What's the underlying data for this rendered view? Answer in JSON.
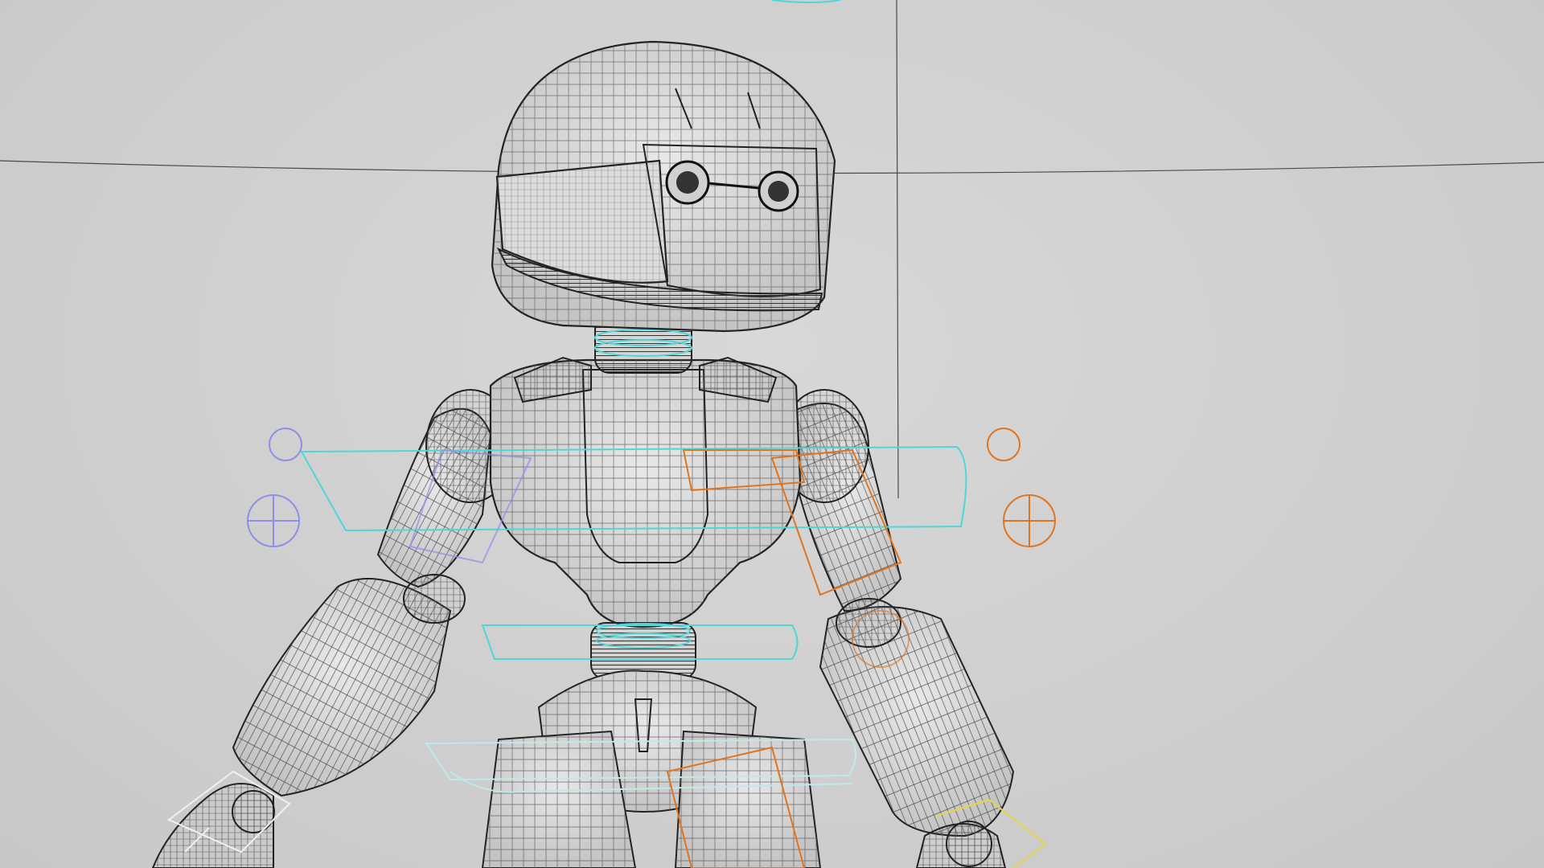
{
  "viewport": {
    "background_color": "#cfcfcf",
    "wire_color": "#2a2a2a",
    "grid_line_color": "#4a4a4a"
  },
  "rig": {
    "spine_control_color": "#4fd6d6",
    "right_side_control_color": "#e0741f",
    "left_side_control_color": "#8e8ee8",
    "hand_ik_color": "#f0f0f0",
    "right_hand_ik_color": "#e6d34a"
  },
  "icons": {
    "left_pole_vector": "crosshair-circle-icon",
    "right_pole_vector": "crosshair-circle-icon",
    "left_shoulder_control": "circle-icon",
    "right_shoulder_control": "circle-icon"
  }
}
